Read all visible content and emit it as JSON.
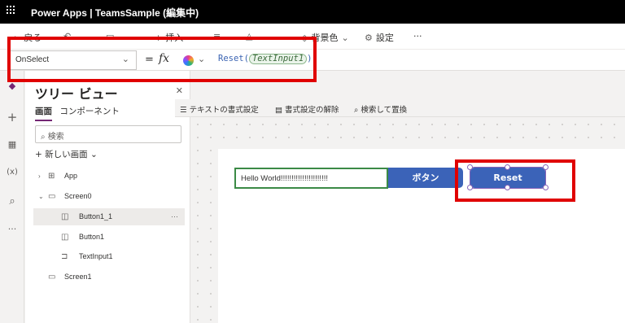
{
  "titlebar": {
    "title": "Power Apps | TeamsSample (編集中)"
  },
  "commandbar": {
    "back": "戻る",
    "insert": "挿入",
    "bgcolor": "背景色",
    "settings": "設定",
    "more": "···"
  },
  "formulabar": {
    "property": "OnSelect",
    "equals": "=",
    "fx": "fx",
    "func": "Reset",
    "arg": "TextInput1",
    "suffix": ";"
  },
  "rail": {
    "add": "+",
    "data": "▦",
    "vars": "(x)",
    "search": "⌕",
    "more": "···"
  },
  "tree": {
    "title": "ツリー ビュー",
    "tabs": [
      "画面",
      "コンポーネント"
    ],
    "search_placeholder": "検索",
    "new_screen": "新しい画面",
    "nodes": [
      "App",
      "Screen0",
      "Button1_1",
      "Button1",
      "TextInput1",
      "Screen1"
    ],
    "more": "···"
  },
  "format": {
    "text_format": "テキストの書式設定",
    "clear_format": "書式設定の解除",
    "find_replace": "検索して置換"
  },
  "canvas": {
    "input_value": "Hello World!!!!!!!!!!!!!!!!!!!!!!",
    "button_label": "ボタン",
    "reset_label": "Reset"
  },
  "colors": {
    "accent": "#742774",
    "button": "#3b63b8",
    "highlight": "#e00000",
    "input_border": "#3b8a46"
  }
}
